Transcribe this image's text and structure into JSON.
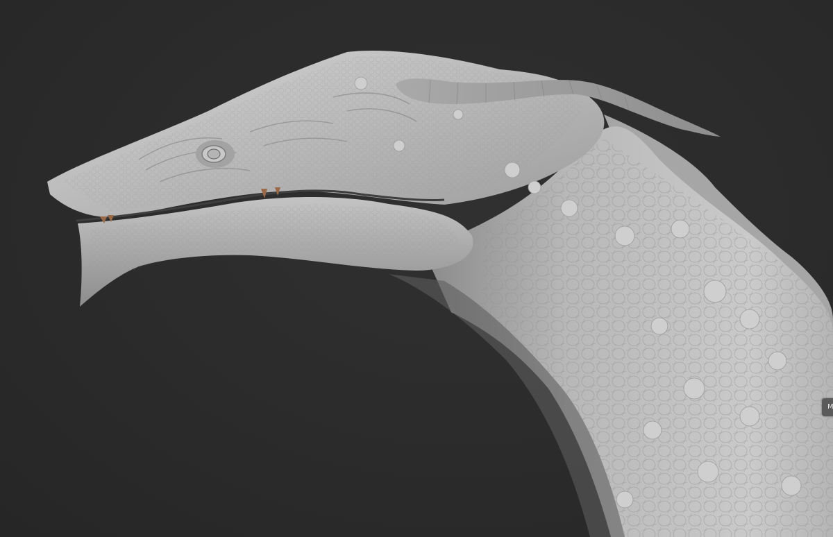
{
  "viewport": {
    "background_color": "#2b2b2b",
    "model_subject": "creature-head-sculpt",
    "material_color": "#bdbdbd",
    "teeth_color": "#9a6a48"
  },
  "side_tab": {
    "label": "M",
    "icon": "menu-tab"
  }
}
